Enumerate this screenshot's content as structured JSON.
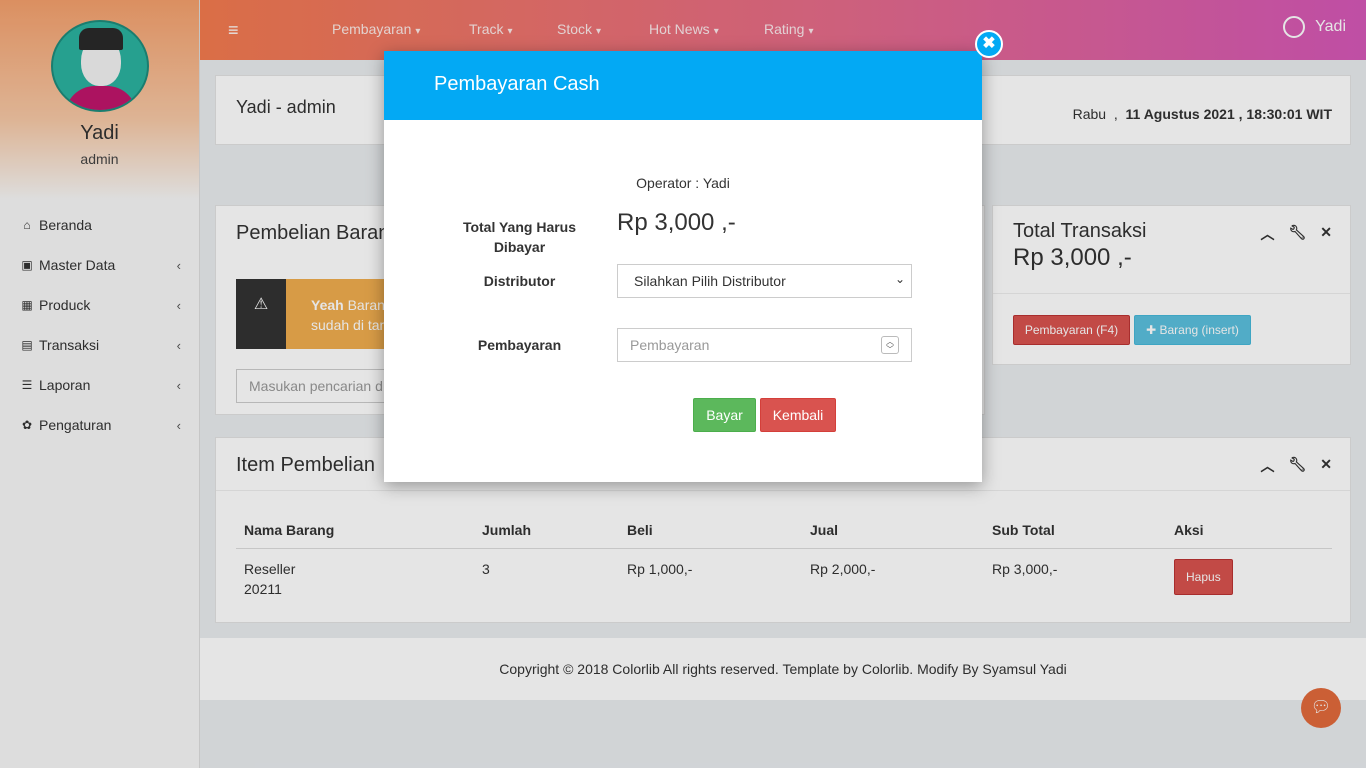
{
  "sidebar": {
    "user_name": "Yadi",
    "user_role": "admin",
    "items": [
      {
        "label": "Beranda",
        "icon": "home-icon",
        "has_chevron": false
      },
      {
        "label": "Master Data",
        "icon": "briefcase-icon",
        "has_chevron": true
      },
      {
        "label": "Produck",
        "icon": "grid-icon",
        "has_chevron": true
      },
      {
        "label": "Transaksi",
        "icon": "money-icon",
        "has_chevron": true
      },
      {
        "label": "Laporan",
        "icon": "list-icon",
        "has_chevron": true
      },
      {
        "label": "Pengaturan",
        "icon": "gear-icon",
        "has_chevron": true
      }
    ]
  },
  "topnav": {
    "items": [
      "Pembayaran",
      "Track",
      "Stock",
      "Hot News",
      "Rating"
    ],
    "user": "Yadi"
  },
  "header": {
    "title": "Yadi - admin",
    "day": "Rabu",
    "datetime": "11 Agustus 2021 , 18:30:01 WIT"
  },
  "pembelian": {
    "title": "Pembelian Barang",
    "alert_bold": "Yeah",
    "alert_text1": "Barang",
    "alert_text2": "sudah di tam",
    "search_placeholder": "Masukan pencarian d"
  },
  "transaksi": {
    "title": "Total Transaksi",
    "total": "Rp 3,000 ,-",
    "btn_pay": "Pembayaran (F4)",
    "btn_barang": "Barang (insert)"
  },
  "items": {
    "title": "Item Pembelian",
    "columns": [
      "Nama Barang",
      "Jumlah",
      "Beli",
      "Jual",
      "Sub Total",
      "Aksi"
    ],
    "rows": [
      {
        "nama1": "Reseller",
        "nama2": "20211",
        "jumlah": "3",
        "beli": "Rp 1,000,-",
        "jual": "Rp 2,000,-",
        "subtotal": "Rp 3,000,-",
        "aksi": "Hapus"
      }
    ]
  },
  "footer": {
    "text": "Copyright © 2018 Colorlib All rights reserved. Template by Colorlib. Modify By Syamsul Yadi"
  },
  "modal": {
    "title": "Pembayaran Cash",
    "operator": "Operator : Yadi",
    "total_label1": "Total Yang Harus",
    "total_label2": "Dibayar",
    "total_value": "Rp 3,000 ,-",
    "distributor_label": "Distributor",
    "distributor_value": "Silahkan Pilih Distributor",
    "pembayaran_label": "Pembayaran",
    "pembayaran_placeholder": "Pembayaran",
    "btn_bayar": "Bayar",
    "btn_kembali": "Kembali"
  },
  "colors": {
    "modal_header": "#03a9f4",
    "success": "#5cb85c",
    "danger": "#d9534f",
    "info": "#5bc0de",
    "warning": "#f0ad4e"
  }
}
